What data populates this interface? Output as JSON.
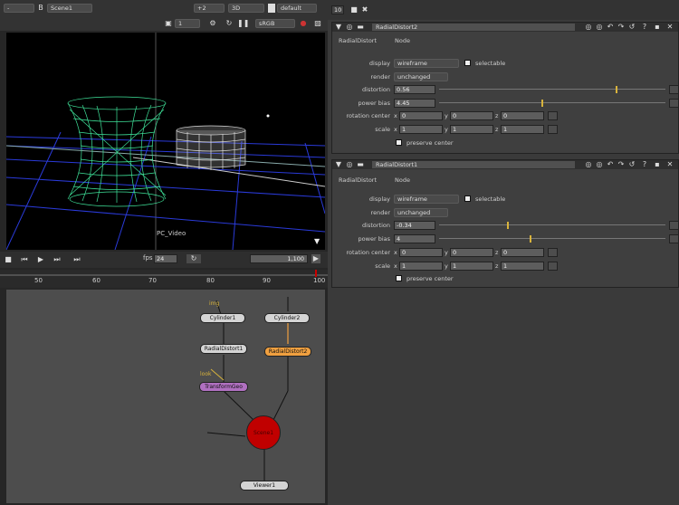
{
  "viewer_toolbar": {
    "channel": "-",
    "layer": "Scene1",
    "gain": "+2",
    "view": "3D",
    "camera": "default",
    "frame_a": "10",
    "frame_b": "1",
    "lut": "sRGB",
    "dim": "3K"
  },
  "viewport": {
    "label": "PC_Video"
  },
  "timeline": {
    "fps_label": "fps",
    "fps": "24",
    "end_frame": "1,100",
    "ticks": [
      "50",
      "60",
      "70",
      "80",
      "90",
      "100"
    ],
    "frame_field": "1,100"
  },
  "nodes": {
    "img": "img",
    "cylinder1": "Cylinder1",
    "cylinder2": "Cylinder2",
    "radialdistort1": "RadialDistort1",
    "radialdistort2": "RadialDistort2",
    "transformgeo": "TransformGeo",
    "scene": "Scene1",
    "viewer": "Viewer1",
    "look": "look"
  },
  "panel1": {
    "title": "RadialDistort2",
    "tabs": [
      "RadialDistort",
      "Node"
    ],
    "display_label": "display",
    "display": "wireframe",
    "selectable": "selectable",
    "render_label": "render",
    "render": "unchanged",
    "distortion_label": "distortion",
    "distortion": "0.56",
    "powerbias_label": "power bias",
    "powerbias": "4.45",
    "rotation_label": "rotation center",
    "rx": "0",
    "ry": "0",
    "rz": "0",
    "scale_label": "scale",
    "sx": "1",
    "sy": "1",
    "sz": "1",
    "preserve": "preserve center",
    "distortion_level": 0.78,
    "powerbias_level": 0.45
  },
  "panel2": {
    "title": "RadialDistort1",
    "tabs": [
      "RadialDistort",
      "Node"
    ],
    "display_label": "display",
    "display": "wireframe",
    "selectable": "selectable",
    "render_label": "render",
    "render": "unchanged",
    "distortion_label": "distortion",
    "distortion": "-0.34",
    "powerbias_label": "power bias",
    "powerbias": "4",
    "rotation_label": "rotation center",
    "rx": "0",
    "ry": "0",
    "rz": "0",
    "scale_label": "scale",
    "sx": "1",
    "sy": "1",
    "sz": "1",
    "preserve": "preserve center",
    "distortion_level": 0.3,
    "powerbias_level": 0.4
  },
  "axis": {
    "x": "x",
    "y": "y",
    "z": "z"
  },
  "colors": {
    "green": "#3fe39a",
    "orange": "#f0a040",
    "purple": "#b070c0",
    "red": "#c00000",
    "yellow": "#d8b33c"
  }
}
